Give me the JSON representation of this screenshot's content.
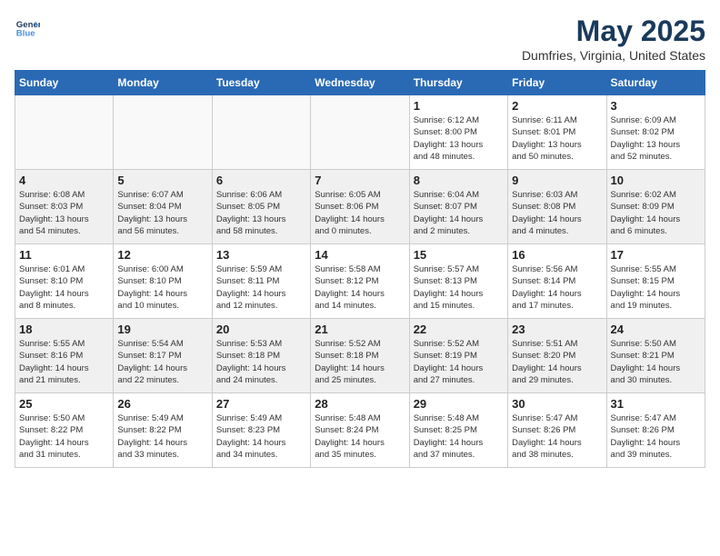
{
  "header": {
    "logo_line1": "General",
    "logo_line2": "Blue",
    "month": "May 2025",
    "location": "Dumfries, Virginia, United States"
  },
  "weekdays": [
    "Sunday",
    "Monday",
    "Tuesday",
    "Wednesday",
    "Thursday",
    "Friday",
    "Saturday"
  ],
  "weeks": [
    [
      {
        "day": "",
        "info": ""
      },
      {
        "day": "",
        "info": ""
      },
      {
        "day": "",
        "info": ""
      },
      {
        "day": "",
        "info": ""
      },
      {
        "day": "1",
        "info": "Sunrise: 6:12 AM\nSunset: 8:00 PM\nDaylight: 13 hours\nand 48 minutes."
      },
      {
        "day": "2",
        "info": "Sunrise: 6:11 AM\nSunset: 8:01 PM\nDaylight: 13 hours\nand 50 minutes."
      },
      {
        "day": "3",
        "info": "Sunrise: 6:09 AM\nSunset: 8:02 PM\nDaylight: 13 hours\nand 52 minutes."
      }
    ],
    [
      {
        "day": "4",
        "info": "Sunrise: 6:08 AM\nSunset: 8:03 PM\nDaylight: 13 hours\nand 54 minutes."
      },
      {
        "day": "5",
        "info": "Sunrise: 6:07 AM\nSunset: 8:04 PM\nDaylight: 13 hours\nand 56 minutes."
      },
      {
        "day": "6",
        "info": "Sunrise: 6:06 AM\nSunset: 8:05 PM\nDaylight: 13 hours\nand 58 minutes."
      },
      {
        "day": "7",
        "info": "Sunrise: 6:05 AM\nSunset: 8:06 PM\nDaylight: 14 hours\nand 0 minutes."
      },
      {
        "day": "8",
        "info": "Sunrise: 6:04 AM\nSunset: 8:07 PM\nDaylight: 14 hours\nand 2 minutes."
      },
      {
        "day": "9",
        "info": "Sunrise: 6:03 AM\nSunset: 8:08 PM\nDaylight: 14 hours\nand 4 minutes."
      },
      {
        "day": "10",
        "info": "Sunrise: 6:02 AM\nSunset: 8:09 PM\nDaylight: 14 hours\nand 6 minutes."
      }
    ],
    [
      {
        "day": "11",
        "info": "Sunrise: 6:01 AM\nSunset: 8:10 PM\nDaylight: 14 hours\nand 8 minutes."
      },
      {
        "day": "12",
        "info": "Sunrise: 6:00 AM\nSunset: 8:10 PM\nDaylight: 14 hours\nand 10 minutes."
      },
      {
        "day": "13",
        "info": "Sunrise: 5:59 AM\nSunset: 8:11 PM\nDaylight: 14 hours\nand 12 minutes."
      },
      {
        "day": "14",
        "info": "Sunrise: 5:58 AM\nSunset: 8:12 PM\nDaylight: 14 hours\nand 14 minutes."
      },
      {
        "day": "15",
        "info": "Sunrise: 5:57 AM\nSunset: 8:13 PM\nDaylight: 14 hours\nand 15 minutes."
      },
      {
        "day": "16",
        "info": "Sunrise: 5:56 AM\nSunset: 8:14 PM\nDaylight: 14 hours\nand 17 minutes."
      },
      {
        "day": "17",
        "info": "Sunrise: 5:55 AM\nSunset: 8:15 PM\nDaylight: 14 hours\nand 19 minutes."
      }
    ],
    [
      {
        "day": "18",
        "info": "Sunrise: 5:55 AM\nSunset: 8:16 PM\nDaylight: 14 hours\nand 21 minutes."
      },
      {
        "day": "19",
        "info": "Sunrise: 5:54 AM\nSunset: 8:17 PM\nDaylight: 14 hours\nand 22 minutes."
      },
      {
        "day": "20",
        "info": "Sunrise: 5:53 AM\nSunset: 8:18 PM\nDaylight: 14 hours\nand 24 minutes."
      },
      {
        "day": "21",
        "info": "Sunrise: 5:52 AM\nSunset: 8:18 PM\nDaylight: 14 hours\nand 25 minutes."
      },
      {
        "day": "22",
        "info": "Sunrise: 5:52 AM\nSunset: 8:19 PM\nDaylight: 14 hours\nand 27 minutes."
      },
      {
        "day": "23",
        "info": "Sunrise: 5:51 AM\nSunset: 8:20 PM\nDaylight: 14 hours\nand 29 minutes."
      },
      {
        "day": "24",
        "info": "Sunrise: 5:50 AM\nSunset: 8:21 PM\nDaylight: 14 hours\nand 30 minutes."
      }
    ],
    [
      {
        "day": "25",
        "info": "Sunrise: 5:50 AM\nSunset: 8:22 PM\nDaylight: 14 hours\nand 31 minutes."
      },
      {
        "day": "26",
        "info": "Sunrise: 5:49 AM\nSunset: 8:22 PM\nDaylight: 14 hours\nand 33 minutes."
      },
      {
        "day": "27",
        "info": "Sunrise: 5:49 AM\nSunset: 8:23 PM\nDaylight: 14 hours\nand 34 minutes."
      },
      {
        "day": "28",
        "info": "Sunrise: 5:48 AM\nSunset: 8:24 PM\nDaylight: 14 hours\nand 35 minutes."
      },
      {
        "day": "29",
        "info": "Sunrise: 5:48 AM\nSunset: 8:25 PM\nDaylight: 14 hours\nand 37 minutes."
      },
      {
        "day": "30",
        "info": "Sunrise: 5:47 AM\nSunset: 8:26 PM\nDaylight: 14 hours\nand 38 minutes."
      },
      {
        "day": "31",
        "info": "Sunrise: 5:47 AM\nSunset: 8:26 PM\nDaylight: 14 hours\nand 39 minutes."
      }
    ]
  ]
}
